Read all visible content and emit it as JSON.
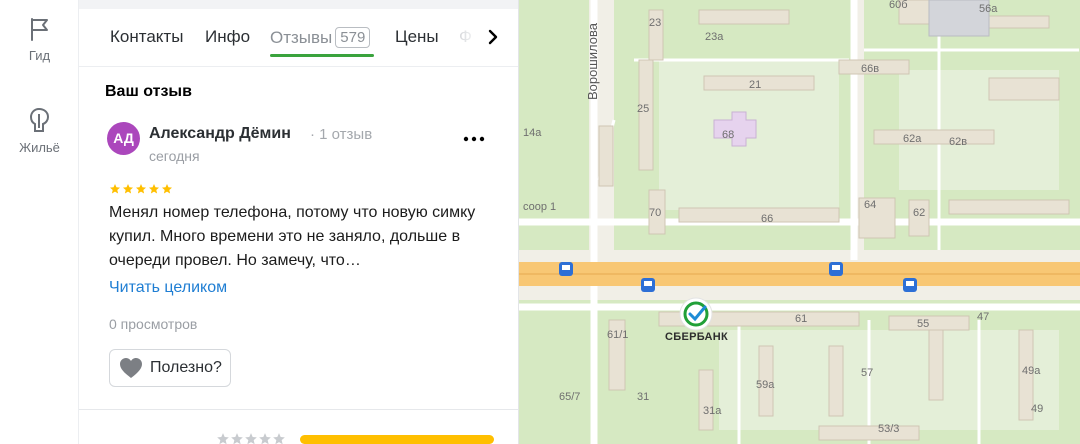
{
  "rail": {
    "items": [
      {
        "label": "Гид",
        "icon": "flag-icon"
      },
      {
        "label": "Жильё",
        "icon": "buildings-icon"
      }
    ]
  },
  "tabs": {
    "items": [
      {
        "label": "Контакты"
      },
      {
        "label": "Инфо"
      },
      {
        "label": "Отзывы",
        "count": "579",
        "active": true
      },
      {
        "label": "Цены"
      },
      {
        "label": "Ф"
      }
    ]
  },
  "review": {
    "section_title": "Ваш отзыв",
    "avatar_initials": "АД",
    "avatar_color": "#ab47bc",
    "author": "Александр Дёмин",
    "author_meta": "· 1 отзыв",
    "date": "сегодня",
    "rating": 5,
    "text": "Менял номер телефона, потому что новую симку купил. Много времени это не заняло, дольше в очереди провел. Но замечу, что…",
    "read_more": "Читать целиком",
    "views": "0 просмотров",
    "useful_label": "Полезно?"
  },
  "map": {
    "street_label": "Ворошилова",
    "poi_label": "СБЕРБАНК",
    "house_numbers": [
      "23",
      "23а",
      "60б",
      "56а",
      "66в",
      "21",
      "14а",
      "25",
      "68",
      "62а",
      "62в",
      "соор 1",
      "70",
      "66",
      "64",
      "62",
      "61",
      "55",
      "47",
      "61/1",
      "57",
      "59а",
      "49а",
      "65/7",
      "31",
      "31а",
      "53/3",
      "49"
    ]
  },
  "colors": {
    "accent_tab": "#3aa33d",
    "link": "#1f7ed3",
    "star": "#ffbf00",
    "bus_stop": "#2d6fd6"
  }
}
